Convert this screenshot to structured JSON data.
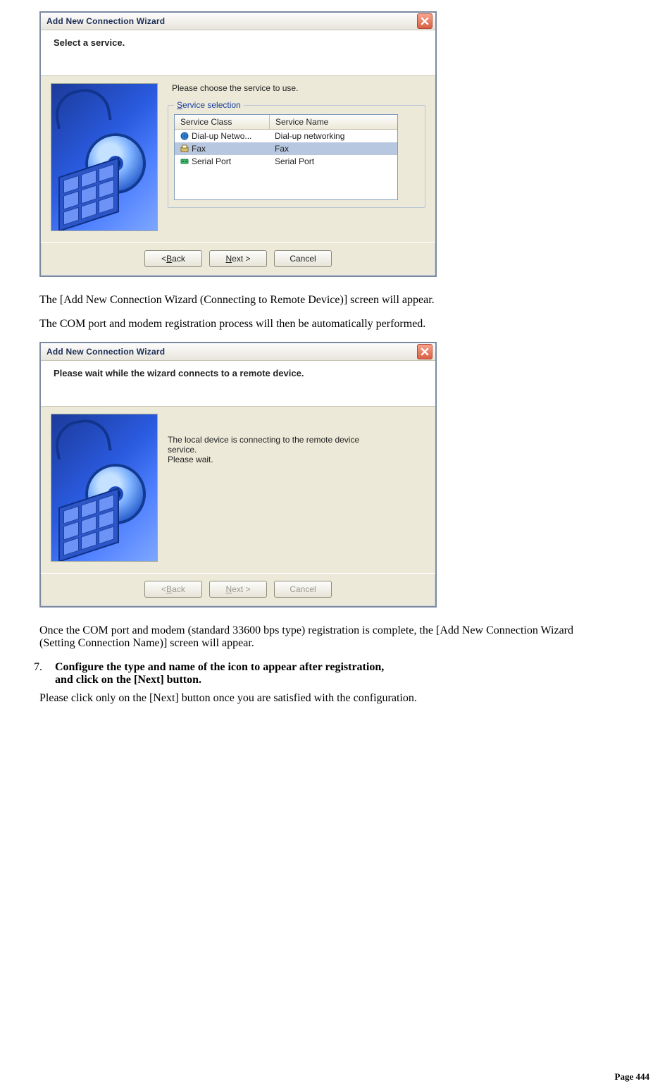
{
  "dialog1": {
    "title": "Add New Connection Wizard",
    "heading": "Select a service.",
    "instruction": "Please choose the service to use.",
    "group_legend_prefix_underlined": "S",
    "group_legend_rest": "ervice selection",
    "list": {
      "columns": [
        "Service Class",
        "Service Name"
      ],
      "rows": [
        {
          "class": "Dial-up Netwo...",
          "name": "Dial-up networking",
          "icon": "globe-icon",
          "selected": false
        },
        {
          "class": "Fax",
          "name": "Fax",
          "icon": "fax-icon",
          "selected": true
        },
        {
          "class": "Serial Port",
          "name": "Serial Port",
          "icon": "port-icon",
          "selected": false
        }
      ]
    },
    "buttons": {
      "back_prefix": "< ",
      "back_und": "B",
      "back_rest": "ack",
      "next_und": "N",
      "next_rest": "ext >",
      "cancel": "Cancel"
    }
  },
  "para1": "The [Add New Connection Wizard (Connecting to Remote Device)] screen will appear.",
  "para2": "The COM port and modem registration process will then be automatically performed.",
  "dialog2": {
    "title": "Add New Connection Wizard",
    "heading": "Please wait while the wizard connects to a remote device.",
    "msg_line1": "The local device is connecting to the remote device",
    "msg_line2": "service.",
    "msg_line3": "Please wait.",
    "buttons": {
      "back_prefix": "< ",
      "back_und": "B",
      "back_rest": "ack",
      "next_und": "N",
      "next_rest": "ext >",
      "cancel": "Cancel"
    }
  },
  "para3": "Once the COM port and modem (standard 33600 bps type) registration is complete, the [Add New Connection Wizard (Setting Connection Name)] screen will appear.",
  "step": {
    "num": "7.",
    "line1": "Configure the type and name of the icon to appear after registration,",
    "line2": "and click on the [Next] button."
  },
  "para4": "Please click only on the [Next] button once you are satisfied with the configuration.",
  "page_footer": "Page 444",
  "chart_data": {
    "type": "table",
    "title": "Service selection",
    "columns": [
      "Service Class",
      "Service Name"
    ],
    "rows": [
      [
        "Dial-up Netwo...",
        "Dial-up networking"
      ],
      [
        "Fax",
        "Fax"
      ],
      [
        "Serial Port",
        "Serial Port"
      ]
    ],
    "selected_index": 1
  }
}
